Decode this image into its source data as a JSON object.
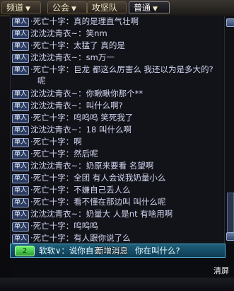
{
  "tabs": [
    {
      "label": "频道",
      "has_arrow": true,
      "active": false
    },
    {
      "label": "公会",
      "has_arrow": true,
      "active": false
    },
    {
      "label": "攻坚队",
      "has_arrow": false,
      "active": false
    },
    {
      "label": "普通",
      "has_arrow": true,
      "active": true
    }
  ],
  "chat": {
    "badge": "单人",
    "lines": [
      {
        "prefix": "·死亡十字：",
        "text": "真的是理直气壮啊"
      },
      {
        "prefix": "沈沈沈青衣~：",
        "text": "笑nm"
      },
      {
        "prefix": "·死亡十字：",
        "text": "太猛了    真的是"
      },
      {
        "prefix": "沈沈沈青衣~：",
        "text": "sm万一"
      },
      {
        "prefix": "·死亡十字：",
        "text": "巨龙  都这么厉害么  我还以为是多大的?",
        "cont": "呢"
      },
      {
        "prefix": "沈沈沈青衣~：",
        "text": "你瞅瞅你那个**"
      },
      {
        "prefix": "沈沈沈青衣~：",
        "text": "叫什么啊?"
      },
      {
        "prefix": "·死亡十字：",
        "text": "呜呜呜  笑死我了"
      },
      {
        "prefix": "沈沈沈青衣~：",
        "text": "18  叫什么啊"
      },
      {
        "prefix": "·死亡十字：",
        "text": "啊"
      },
      {
        "prefix": "·死亡十字：",
        "text": "然后呢"
      },
      {
        "prefix": "沈沈沈青衣~：",
        "text": "奶原来要看  名望啊"
      },
      {
        "prefix": "·死亡十字：",
        "text": "全团  有人会说我奶量小么"
      },
      {
        "prefix": "·死亡十字：",
        "text": "不嫌自己丢人么"
      },
      {
        "prefix": "·死亡十字：",
        "text": "看不懂在那边叫  叫什么呢"
      },
      {
        "prefix": "沈沈沈青衣~：",
        "text": "奶量大  人是nt  有啥用啊"
      },
      {
        "prefix": "·死亡十字：",
        "text": "呜呜呜"
      },
      {
        "prefix": "·死亡十字：",
        "text": "有人跟你说了么"
      }
    ]
  },
  "new_message": {
    "level": "2",
    "sender": "软软∨：说你自己",
    "label": "新增消息",
    "tail": "你在叫什么?"
  },
  "clear_button": "清屏"
}
